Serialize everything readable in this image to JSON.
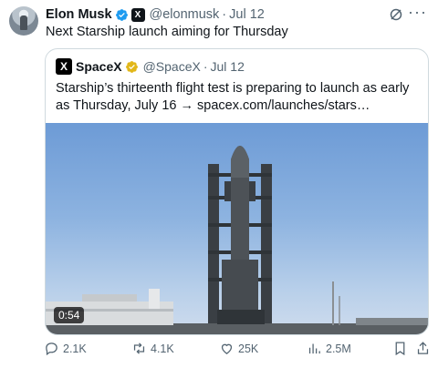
{
  "post": {
    "author_name": "Elon Musk",
    "author_handle": "@elonmusk",
    "date": "Jul 12",
    "separator": "·",
    "text": "Next Starship launch aiming for Thursday",
    "more_icon": "more-horizontal-icon"
  },
  "quoted": {
    "logo_letter": "X",
    "author_name": "SpaceX",
    "author_handle": "@SpaceX",
    "date": "Jul 12",
    "separator": "·",
    "text": "Starship’s thirteenth flight test is preparing to launch as early as Thursday, July 16 → spacex.com/launches/stars…",
    "video_duration": "0:54"
  },
  "actions": {
    "replies": "2.1K",
    "reposts": "4.1K",
    "likes": "25K",
    "views": "2.5M"
  },
  "colors": {
    "verified_blue": "#1d9bf0",
    "verified_gold": "#e2b719",
    "muted_text": "#536471"
  }
}
